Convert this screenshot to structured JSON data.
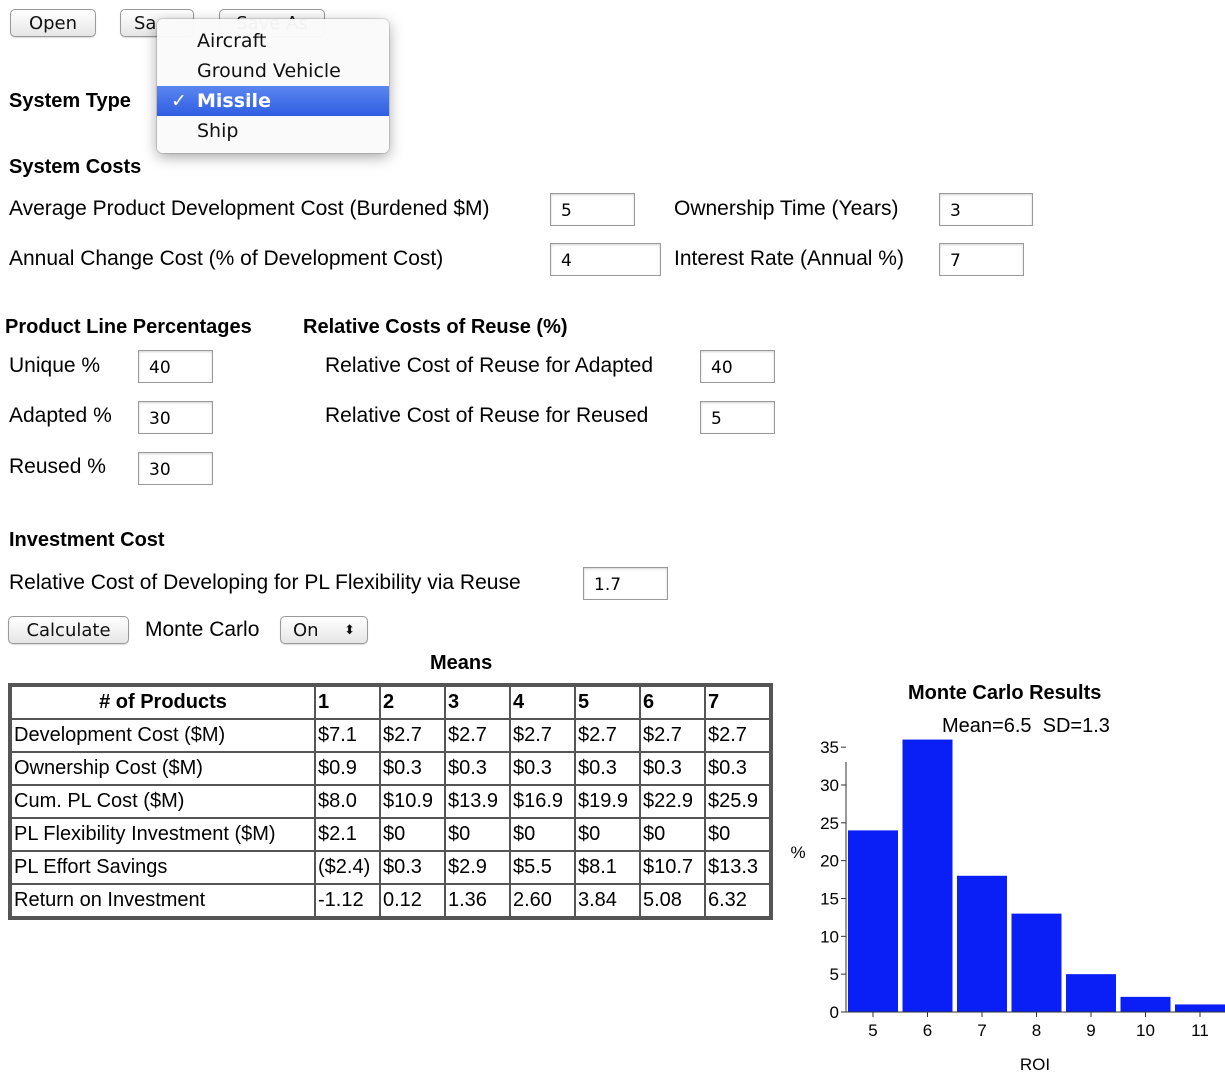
{
  "toolbar": {
    "open_label": "Open",
    "save_label": "Sa",
    "save_as_label": "Save As"
  },
  "system_type": {
    "label": "System Type",
    "options": [
      "Aircraft",
      "Ground Vehicle",
      "Missile",
      "Ship"
    ],
    "selected": "Missile",
    "check_glyph": "✓"
  },
  "system_costs": {
    "heading": "System Costs",
    "dev_cost_label": "Average Product Development Cost (Burdened $M)",
    "dev_cost_value": "5",
    "ownership_label": "Ownership Time (Years)",
    "ownership_value": "3",
    "change_cost_label": "Annual Change Cost (% of Development Cost)",
    "change_cost_value": "4",
    "interest_label": "Interest Rate (Annual %)",
    "interest_value": "7"
  },
  "product_line": {
    "heading": "Product Line Percentages",
    "unique_label": "Unique %",
    "unique_value": "40",
    "adapted_label": "Adapted %",
    "adapted_value": "30",
    "reused_label": "Reused %",
    "reused_value": "30"
  },
  "reuse": {
    "heading": "Relative Costs of Reuse (%)",
    "adapted_label": "Relative Cost of Reuse for Adapted",
    "adapted_value": "40",
    "reused_label": "Relative Cost of Reuse for Reused",
    "reused_value": "5"
  },
  "investment": {
    "heading": "Investment Cost",
    "flex_label": "Relative Cost of Developing for PL Flexibility via Reuse",
    "flex_value": "1.7"
  },
  "actions": {
    "calculate_label": "Calculate",
    "monte_carlo_label": "Monte Carlo",
    "monte_carlo_value": "On",
    "select_arrows": "⬍"
  },
  "means_table": {
    "title": "Means",
    "headers": [
      "# of Products",
      "1",
      "2",
      "3",
      "4",
      "5",
      "6",
      "7"
    ],
    "rows": [
      [
        "Development Cost ($M)",
        "$7.1",
        "$2.7",
        "$2.7",
        "$2.7",
        "$2.7",
        "$2.7",
        "$2.7"
      ],
      [
        "Ownership Cost ($M)",
        "$0.9",
        "$0.3",
        "$0.3",
        "$0.3",
        "$0.3",
        "$0.3",
        "$0.3"
      ],
      [
        "Cum. PL Cost ($M)",
        "$8.0",
        "$10.9",
        "$13.9",
        "$16.9",
        "$19.9",
        "$22.9",
        "$25.9"
      ],
      [
        "PL Flexibility Investment ($M)",
        "$2.1",
        "$0",
        "$0",
        "$0",
        "$0",
        "$0",
        "$0"
      ],
      [
        "PL Effort Savings",
        "($2.4)",
        "$0.3",
        "$2.9",
        "$5.5",
        "$8.1",
        "$10.7",
        "$13.3"
      ],
      [
        "Return on Investment",
        "-1.12",
        "0.12",
        "1.36",
        "2.60",
        "3.84",
        "5.08",
        "6.32"
      ]
    ]
  },
  "chart_data": {
    "type": "bar",
    "title": "Monte Carlo Results",
    "subtitle": "Mean=6.5  SD=1.3",
    "xlabel": "ROI",
    "ylabel": "%",
    "categories": [
      "5",
      "6",
      "7",
      "8",
      "9",
      "10",
      "11"
    ],
    "values": [
      24,
      36,
      18,
      13,
      5,
      2,
      1
    ],
    "ylim": [
      0,
      37
    ],
    "yticks": [
      0,
      5,
      10,
      15,
      20,
      25,
      30,
      35
    ],
    "bar_color": "#0a1ff5",
    "grid": false
  }
}
